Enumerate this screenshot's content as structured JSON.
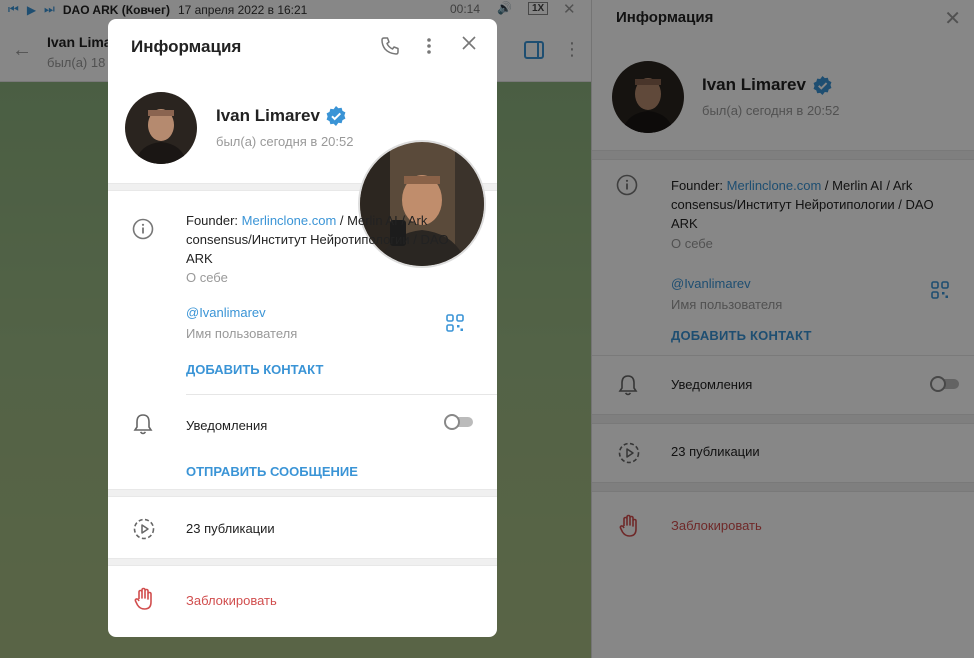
{
  "player": {
    "track_title": "DAO ARK (Ковчег)",
    "track_date": "17 апреля 2022 в 16:21",
    "time": "00:14",
    "speed": "1X"
  },
  "chat_header": {
    "name": "Ivan Lima",
    "status": "был(а) 18"
  },
  "panel": {
    "title": "Информация",
    "name": "Ivan Limarev",
    "status": "был(а) сегодня в 20:52",
    "bio_prefix": "Founder: ",
    "bio_link": "Merlinclone.com",
    "bio_suffix": " / Merlin AI / Ark consensus/Институт Нейротипологии / DAO ARK",
    "bio_label": "О себе",
    "username": "@Ivanlimarev",
    "username_label": "Имя пользователя",
    "add_contact": "ДОБАВИТЬ КОНТАКТ",
    "notifications_label": "Уведомления",
    "notifications_on": false,
    "publications": "23 публикации",
    "block": "Заблокировать"
  },
  "modal": {
    "title": "Информация",
    "name": "Ivan Limarev",
    "status": "был(а) сегодня в 20:52",
    "bio_prefix": "Founder: ",
    "bio_link": "Merlinclone.com",
    "bio_suffix": " / Merlin AI / Ark consensus/Институт Нейротипологии / DAO ARK",
    "bio_label": "О себе",
    "username": "@Ivanlimarev",
    "username_label": "Имя пользователя",
    "add_contact": "ДОБАВИТЬ КОНТАКТ",
    "notifications_label": "Уведомления",
    "notifications_on": false,
    "send_message": "ОТПРАВИТЬ СООБЩЕНИЕ",
    "publications": "23 публикации",
    "block": "Заблокировать"
  },
  "colors": {
    "accent": "#3a94d6",
    "danger": "#d14e4e",
    "verified": "#3a94d6"
  }
}
